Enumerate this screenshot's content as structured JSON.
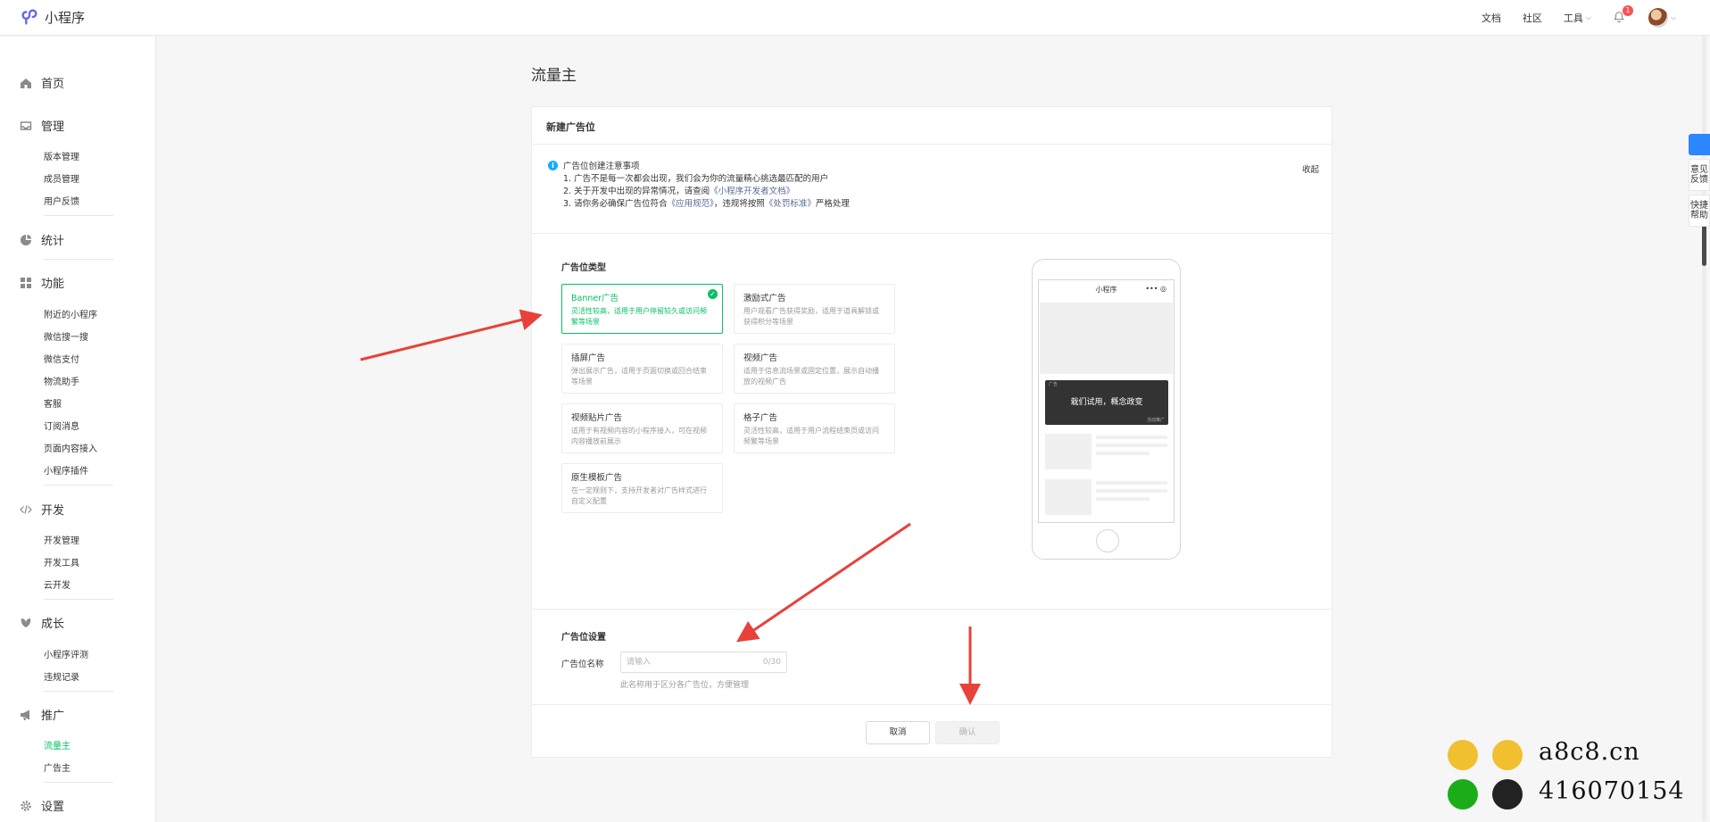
{
  "app": {
    "title": "小程序"
  },
  "topnav": {
    "docs": "文档",
    "community": "社区",
    "tools": "工具",
    "notifications": "1"
  },
  "sidebar": {
    "home": "首页",
    "manage": {
      "label": "管理",
      "items": [
        "版本管理",
        "成员管理",
        "用户反馈"
      ]
    },
    "stats": "统计",
    "features": {
      "label": "功能",
      "items": [
        "附近的小程序",
        "微信搜一搜",
        "微信支付",
        "物流助手",
        "客服",
        "订阅消息",
        "页面内容接入",
        "小程序插件"
      ]
    },
    "dev": {
      "label": "开发",
      "items": [
        "开发管理",
        "开发工具",
        "云开发"
      ]
    },
    "growth": {
      "label": "成长",
      "items": [
        "小程序评测",
        "违规记录"
      ]
    },
    "promo": {
      "label": "推广",
      "items": [
        "流量主",
        "广告主"
      ]
    },
    "settings": "设置"
  },
  "main": {
    "title": "流量主",
    "card_title": "新建广告位",
    "notice": {
      "title": "广告位创建注意事项",
      "line1": "1. 广告不是每一次都会出现，我们会为你的流量精心挑选最匹配的用户",
      "line2a": "2. 关于开发中出现的异常情况，请查阅",
      "line2link": "《小程序开发者文档》",
      "line3a": "3. 请你务必确保广告位符合",
      "line3link1": "《应用规范》",
      "line3b": "，违规将按照",
      "line3link2": "《处罚标准》",
      "line3c": "严格处理",
      "collapse": "收起"
    },
    "type_section": "广告位类型",
    "types": [
      {
        "title": "Banner广告",
        "desc": "灵活性较高，适用于用户停留较久或访问频繁等场景"
      },
      {
        "title": "激励式广告",
        "desc": "用户观看广告获得奖励，适用于道具解锁或获得积分等场景"
      },
      {
        "title": "插屏广告",
        "desc": "弹出展示广告，适用于页面切换或回合结束等场景"
      },
      {
        "title": "视频广告",
        "desc": "适用于信息流场景或固定位置，展示自动播放的视频广告"
      },
      {
        "title": "视频贴片广告",
        "desc": "适用于有视频内容的小程序接入，可在视频内容播放前展示"
      },
      {
        "title": "格子广告",
        "desc": "灵活性较高，适用于用户流程结束页或访问频繁等场景"
      },
      {
        "title": "原生模板广告",
        "desc": "在一定规则下，支持开发者对广告样式进行自定义配置"
      }
    ],
    "phone": {
      "title": "小程序",
      "dots": "••• ◎",
      "banner_text": "栽们试用，概念政变",
      "tag": "广告",
      "tag2": "活动推广"
    },
    "settings_section": "广告位设置",
    "name_label": "广告位名称",
    "name_placeholder": "请输入",
    "name_count": "0/30",
    "name_hint": "此名称用于区分各广告位，方便管理",
    "cancel": "取消",
    "confirm": "确认"
  },
  "float": {
    "feedback": "意见反馈",
    "help": "快捷帮助"
  },
  "watermark": {
    "site": "a8c8.cn",
    "qq": "416070154"
  },
  "colors": {
    "accent": "#07c160",
    "link": "#576b95",
    "arrow": "#e8413a"
  }
}
